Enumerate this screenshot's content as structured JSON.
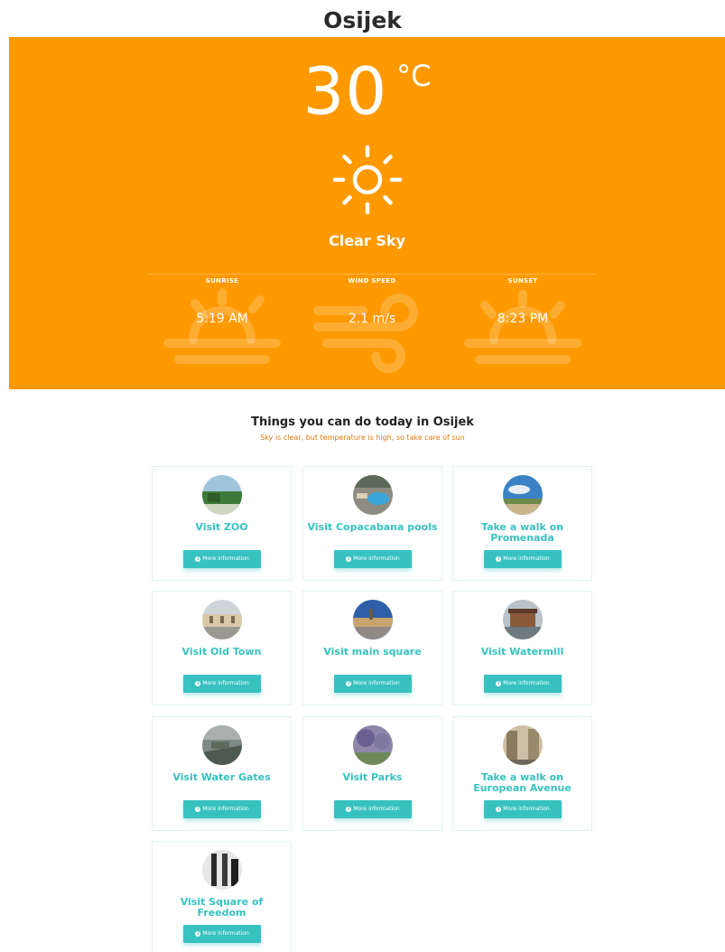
{
  "city": "Osijek",
  "weather": {
    "temperature": "30",
    "unit": "°C",
    "condition": "Clear Sky",
    "icon": "sun-icon",
    "stats": [
      {
        "label": "SUNRISE",
        "value": "5:19 AM",
        "icon": "sunrise-icon"
      },
      {
        "label": "WIND SPEED",
        "value": "2.1 m/s",
        "icon": "wind-icon"
      },
      {
        "label": "SUNSET",
        "value": "8:23 PM",
        "icon": "sunset-icon"
      }
    ],
    "accent": "#fe9900"
  },
  "activities": {
    "title": "Things you can do today in Osijek",
    "subtitle": "Sky is clear, but temperature is high, so take care of sun",
    "button_label": "More information",
    "accent": "#37c2c0",
    "items": [
      {
        "title": "Visit ZOO"
      },
      {
        "title": "Visit Copacabana pools"
      },
      {
        "title": "Take a walk on Promenada"
      },
      {
        "title": "Visit Old Town"
      },
      {
        "title": "Visit main square"
      },
      {
        "title": "Visit Watermill"
      },
      {
        "title": "Visit Water Gates"
      },
      {
        "title": "Visit Parks"
      },
      {
        "title": "Take a walk on European Avenue"
      },
      {
        "title": "Visit Square of Freedom"
      }
    ]
  }
}
